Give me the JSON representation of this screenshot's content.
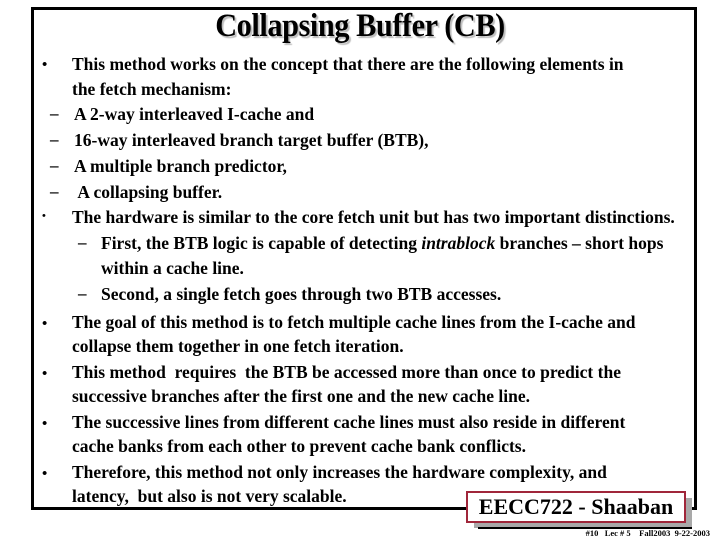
{
  "slide": {
    "title": "Collapsing Buffer (CB)",
    "bullets": [
      {
        "lines": [
          "This method works on the concept that there are the following elements in",
          "the fetch mechanism:"
        ],
        "subs": [
          {
            "lines": [
              "A 2-way  interleaved I-cache and"
            ]
          },
          {
            "lines": [
              "16-way interleaved branch target buffer (BTB),"
            ]
          },
          {
            "lines": [
              "A multiple branch predictor,"
            ]
          },
          {
            "lines": [
              " A collapsing buffer."
            ]
          }
        ]
      },
      {
        "lines": [
          "The hardware is similar to the core fetch unit but has two important distinctions."
        ],
        "subs": [
          {
            "pre": "First, the BTB logic is capable of detecting ",
            "em": "intrablock",
            "post": " branches – short hops",
            "line2": "within a cache line."
          },
          {
            "lines": [
              "Second, a single fetch goes through two BTB accesses."
            ]
          }
        ]
      },
      {
        "lines": [
          "The goal of this method is to fetch multiple cache lines from the I-cache and",
          "collapse them together in one fetch iteration."
        ]
      },
      {
        "lines": [
          "This method  requires  the BTB be accessed more than once to predict the",
          "successive branches after the first one and the new cache line."
        ]
      },
      {
        "lines": [
          "The successive lines from different cache lines must also reside in different",
          "cache banks from each other to prevent cache bank conflicts."
        ]
      },
      {
        "lines": [
          "Therefore, this method not only increases the hardware complexity, and",
          "latency,  but also is not very scalable."
        ]
      }
    ],
    "bullet_glyph": "•",
    "dash_glyph": "–"
  },
  "badge": {
    "label": "EECC722 - Shaaban",
    "border_color": "#a0263a"
  },
  "footer": {
    "text": "#10   Lec # 5    Fall2003  9-22-2003"
  }
}
